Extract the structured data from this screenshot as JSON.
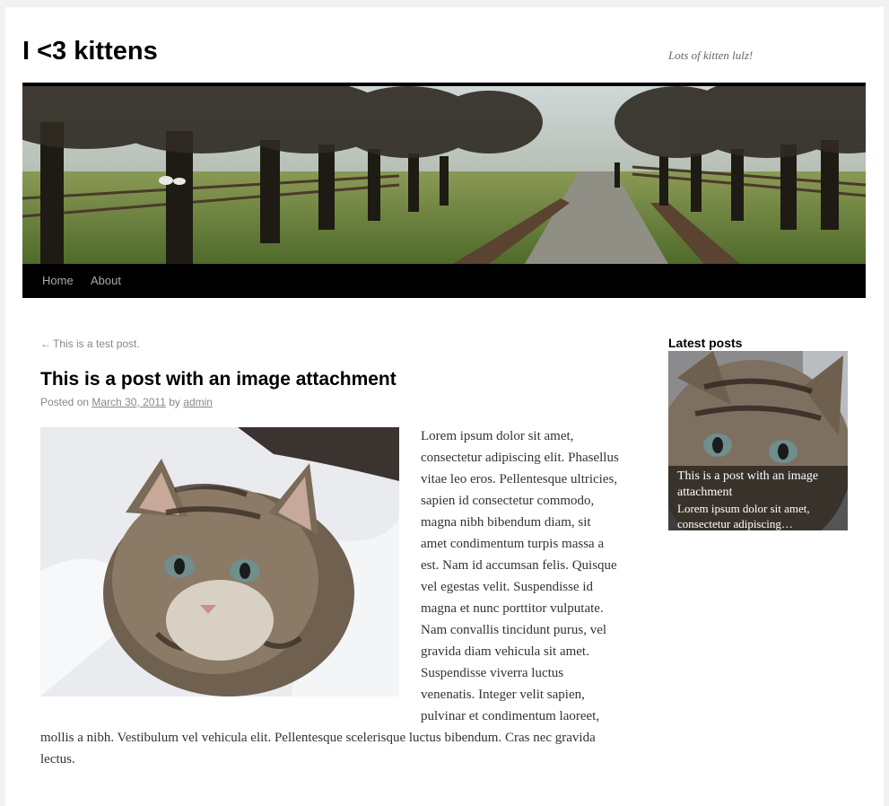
{
  "site": {
    "title": "I <3 kittens",
    "description": "Lots of kitten lulz!"
  },
  "nav": {
    "items": [
      {
        "label": "Home"
      },
      {
        "label": "About"
      }
    ]
  },
  "post": {
    "previous_link": {
      "arrow": "←",
      "label": "This is a test post."
    },
    "title": "This is a post with an image attachment",
    "meta": {
      "posted_on": "Posted on",
      "date": "March 30, 2011",
      "by": "by",
      "author": "admin"
    },
    "body": "Lorem ipsum dolor sit amet, consectetur adipiscing elit. Phasellus vitae leo eros. Pellentesque ultricies, sapien id consectetur commodo, magna nibh bibendum diam, sit amet condimentum turpis massa a est. Nam id accumsan felis. Quisque vel egestas velit. Suspendisse id magna et nunc porttitor vulputate. Nam convallis tincidunt purus, vel gravida diam vehicula sit amet. Suspendisse viverra luctus venenatis. Integer velit sapien, pulvinar et condimentum laoreet, mollis a nibh. Vestibulum vel vehicula elit. Pellentesque scelerisque luctus bibendum. Cras nec gravida lectus."
  },
  "sidebar": {
    "widget_title": "Latest posts",
    "latest": {
      "title": "This is a post with an image attachment",
      "excerpt": "Lorem ipsum dolor sit amet, consectetur adipiscing…"
    }
  },
  "colors": {
    "nav_bg": "#000000",
    "nav_text": "#aaaaaa",
    "page_bg": "#f1f1f1"
  }
}
